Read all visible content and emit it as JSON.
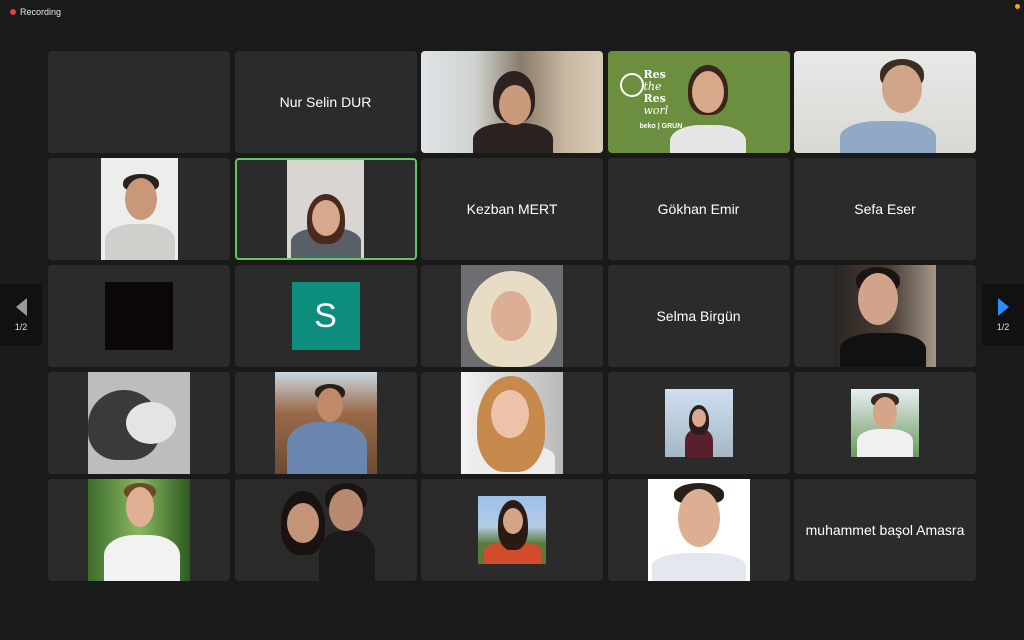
{
  "recording": {
    "label": "Recording"
  },
  "pagination": {
    "current": "1/2"
  },
  "tiles": {
    "t01": "",
    "t02": "Nur Selin DUR",
    "t08": "Kezban MERT",
    "t09": "Gökhan Emir",
    "t10": "Sefa Eser",
    "t12": "S",
    "t14": "Selma Birgün",
    "t25": "muhammet başol Amasra"
  },
  "backgrounds": {
    "banner_words": [
      "Res",
      "the",
      "Res",
      "worl",
      "beko | GRUN"
    ]
  },
  "colors": {
    "recording_dot": "#e5413c",
    "active_speaker_border": "#5fc95f",
    "avatar_s": "#0d8d7d",
    "next_arrow": "#2d8cff",
    "tile_bg": "#2b2b2b"
  },
  "icons": {
    "prev": "chevron-left-icon",
    "next": "chevron-right-icon",
    "record": "record-dot-icon"
  }
}
